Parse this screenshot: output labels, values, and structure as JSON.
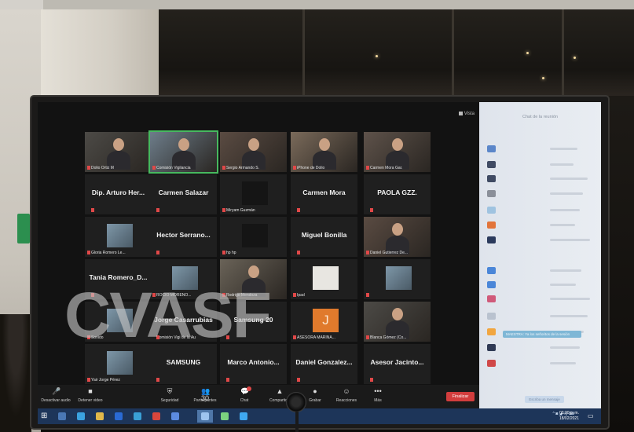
{
  "watermark": "CVASF",
  "meeting": {
    "view_label": "Vista",
    "tiles": [
      {
        "kind": "video",
        "label": "Dolio Ortiz M"
      },
      {
        "kind": "video",
        "label": "Comisión Vigilancia"
      },
      {
        "kind": "video",
        "label": "Sergio Armando S."
      },
      {
        "kind": "video",
        "label": "iPhone de Dolio"
      },
      {
        "kind": "video",
        "label": "Carmen Mora Gar."
      },
      {
        "kind": "name",
        "label": "Dip. Arturo Her..."
      },
      {
        "kind": "name",
        "label": "Carmen Salazar"
      },
      {
        "kind": "dark",
        "label": "Miryam Guzmán"
      },
      {
        "kind": "name",
        "label": "Carmen Mora"
      },
      {
        "kind": "name",
        "label": "PAOLA GZZ."
      },
      {
        "kind": "image",
        "label": "Gloria Romero Le..."
      },
      {
        "kind": "name",
        "label": "Hector Serrano..."
      },
      {
        "kind": "dark",
        "label": "hp hp"
      },
      {
        "kind": "name",
        "label": "Miguel Bonilla"
      },
      {
        "kind": "video",
        "label": "Daniel Gutierrez De..."
      },
      {
        "kind": "name",
        "label": "Tania  Romero_D..."
      },
      {
        "kind": "image",
        "label": "ROCIO MORENO..."
      },
      {
        "kind": "video",
        "label": "Rodrigo Mendoza"
      },
      {
        "kind": "white",
        "label": "Ipad"
      },
      {
        "kind": "image",
        "label": ""
      },
      {
        "kind": "image",
        "label": "Sonido"
      },
      {
        "kind": "name",
        "label": "Jorge Casarrubias",
        "sub": "Comisión Vigi de la Au"
      },
      {
        "kind": "name",
        "label": "Samsung 20"
      },
      {
        "kind": "letter",
        "label": "ASESORA MARINA...",
        "letter": "J"
      },
      {
        "kind": "video",
        "label": "Blanca Gómez (Co..."
      },
      {
        "kind": "image",
        "label": "Yair Jorge Pérez"
      },
      {
        "kind": "name",
        "label": "SAMSUNG"
      },
      {
        "kind": "name",
        "label": "Marco Antonio..."
      },
      {
        "kind": "name",
        "label": "Daniel Gonzalez..."
      },
      {
        "kind": "name",
        "label": "Asesor Jacinto..."
      }
    ]
  },
  "toolbar": {
    "items": [
      {
        "icon": "microphone-icon",
        "glyph": "🎤",
        "label": "Desactivar audio"
      },
      {
        "icon": "video-camera-icon",
        "glyph": "■",
        "label": "Detener video"
      },
      {
        "icon": "shield-icon",
        "glyph": "⛨",
        "label": "Seguridad"
      },
      {
        "icon": "participants-icon",
        "glyph": "👥",
        "label": "Participantes",
        "count": "30"
      },
      {
        "icon": "chat-icon",
        "glyph": "💬",
        "label": "Chat"
      },
      {
        "icon": "share-screen-icon",
        "glyph": "▲",
        "label": "Compartir p"
      },
      {
        "icon": "record-icon",
        "glyph": "●",
        "label": "Grabar"
      },
      {
        "icon": "reactions-icon",
        "glyph": "☺",
        "label": "Reacciones"
      },
      {
        "icon": "more-icon",
        "glyph": "•••",
        "label": "Más"
      }
    ],
    "leave_label": "Finalizar"
  },
  "chat": {
    "title": "Chat de la reunión",
    "message_preview": "MAESTRA: Ya los señoritos de la sesión",
    "send_label": "Escriba un mensaje"
  },
  "taskbar": {
    "time": "03:20 p. m.",
    "date": "18/02/2021"
  }
}
